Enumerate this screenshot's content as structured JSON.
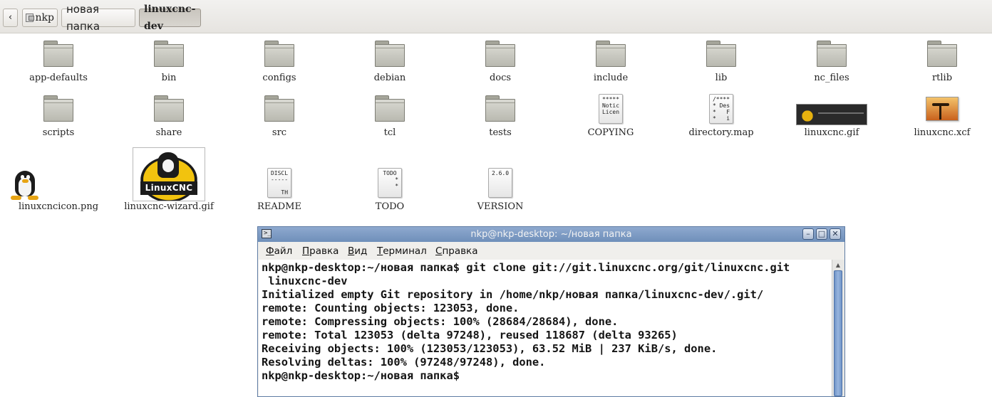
{
  "pathbar": {
    "back_icon": "‹",
    "segments": [
      "nkp",
      "новая папка",
      "linuxcnc-dev"
    ]
  },
  "files": [
    {
      "name": "app-defaults",
      "kind": "folder"
    },
    {
      "name": "bin",
      "kind": "folder"
    },
    {
      "name": "configs",
      "kind": "folder"
    },
    {
      "name": "debian",
      "kind": "folder"
    },
    {
      "name": "docs",
      "kind": "folder"
    },
    {
      "name": "include",
      "kind": "folder"
    },
    {
      "name": "lib",
      "kind": "folder"
    },
    {
      "name": "nc_files",
      "kind": "folder"
    },
    {
      "name": "rtlib",
      "kind": "folder"
    },
    {
      "name": "scripts",
      "kind": "folder"
    },
    {
      "name": "share",
      "kind": "folder"
    },
    {
      "name": "src",
      "kind": "folder"
    },
    {
      "name": "tcl",
      "kind": "folder"
    },
    {
      "name": "tests",
      "kind": "folder"
    },
    {
      "name": "COPYING",
      "kind": "text",
      "preview": "*****\nNotic\nLicen"
    },
    {
      "name": "directory.map",
      "kind": "text",
      "preview": "/****\n* Des\n*   F\n*   i"
    },
    {
      "name": "linuxcnc.gif",
      "kind": "image-gif"
    },
    {
      "name": "linuxcnc.xcf",
      "kind": "image-xcf"
    },
    {
      "name": "linuxcncicon.png",
      "kind": "image-tux"
    },
    {
      "name": "linuxcnc-wizard.gif",
      "kind": "image-wizard",
      "logo_text": "LinuxCNC"
    },
    {
      "name": "README",
      "kind": "text",
      "preview": "DISCL\n-----\n\n   TH"
    },
    {
      "name": "TODO",
      "kind": "text",
      "preview": "TODO\n    *\n    *"
    },
    {
      "name": "VERSION",
      "kind": "text",
      "preview": "2.6.0"
    }
  ],
  "terminal": {
    "title": "nkp@nkp-desktop: ~/новая папка",
    "title_icon": ">_",
    "window_buttons": {
      "minimize": "–",
      "maximize": "□",
      "close": "✕"
    },
    "menu": [
      "Файл",
      "Правка",
      "Вид",
      "Терминал",
      "Справка"
    ],
    "menu_mnemonics": [
      "Ф",
      "П",
      "В",
      "Т",
      "С"
    ],
    "lines": [
      "nkp@nkp-desktop:~/новая папка$ git clone git://git.linuxcnc.org/git/linuxcnc.git",
      " linuxcnc-dev",
      "Initialized empty Git repository in /home/nkp/новая папка/linuxcnc-dev/.git/",
      "remote: Counting objects: 123053, done.",
      "remote: Compressing objects: 100% (28684/28684), done.",
      "remote: Total 123053 (delta 97248), reused 118687 (delta 93265)",
      "Receiving objects: 100% (123053/123053), 63.52 MiB | 237 KiB/s, done.",
      "Resolving deltas: 100% (97248/97248), done.",
      "nkp@nkp-desktop:~/новая папка$ "
    ],
    "scroll_up_icon": "▲"
  }
}
